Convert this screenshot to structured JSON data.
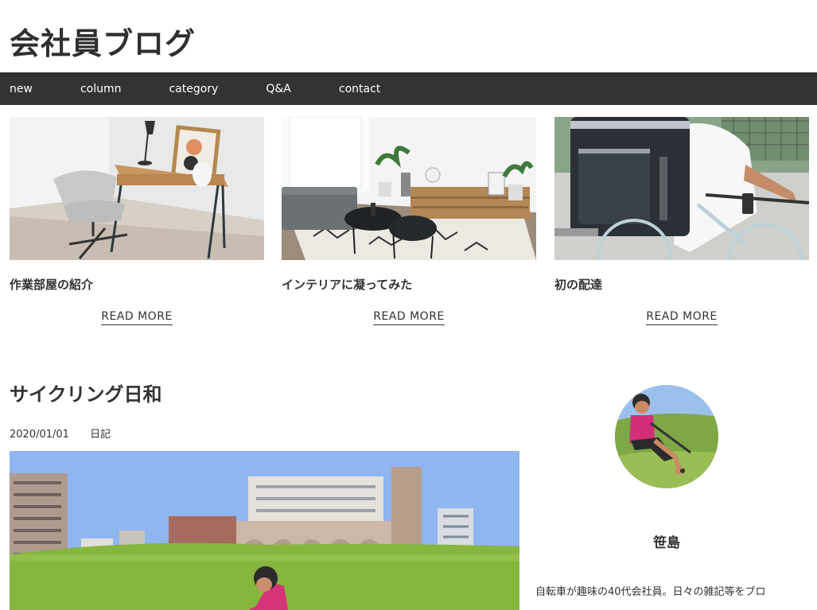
{
  "site": {
    "title": "会社員ブログ"
  },
  "nav": {
    "items": [
      "new",
      "column",
      "category",
      "Q&A",
      "contact"
    ]
  },
  "cards": [
    {
      "title": "作業部屋の紹介",
      "more": "READ MORE",
      "image": "workspace-desk-photo"
    },
    {
      "title": "インテリアに凝ってみた",
      "more": "READ MORE",
      "image": "living-room-photo"
    },
    {
      "title": "初の配達",
      "more": "READ MORE",
      "image": "delivery-bike-photo"
    }
  ],
  "post": {
    "title": "サイクリング日和",
    "date": "2020/01/01",
    "category": "日記",
    "image": "cycling-riverbank-photo"
  },
  "sidebar": {
    "author": "笹島",
    "bio": "自転車が趣味の40代会社員。日々の雑記等をブロ",
    "avatar": "author-avatar-photo"
  },
  "colors": {
    "nav_bg": "#333333",
    "text": "#333333",
    "sky": "#8fb6f0",
    "grass": "#86b63e"
  }
}
